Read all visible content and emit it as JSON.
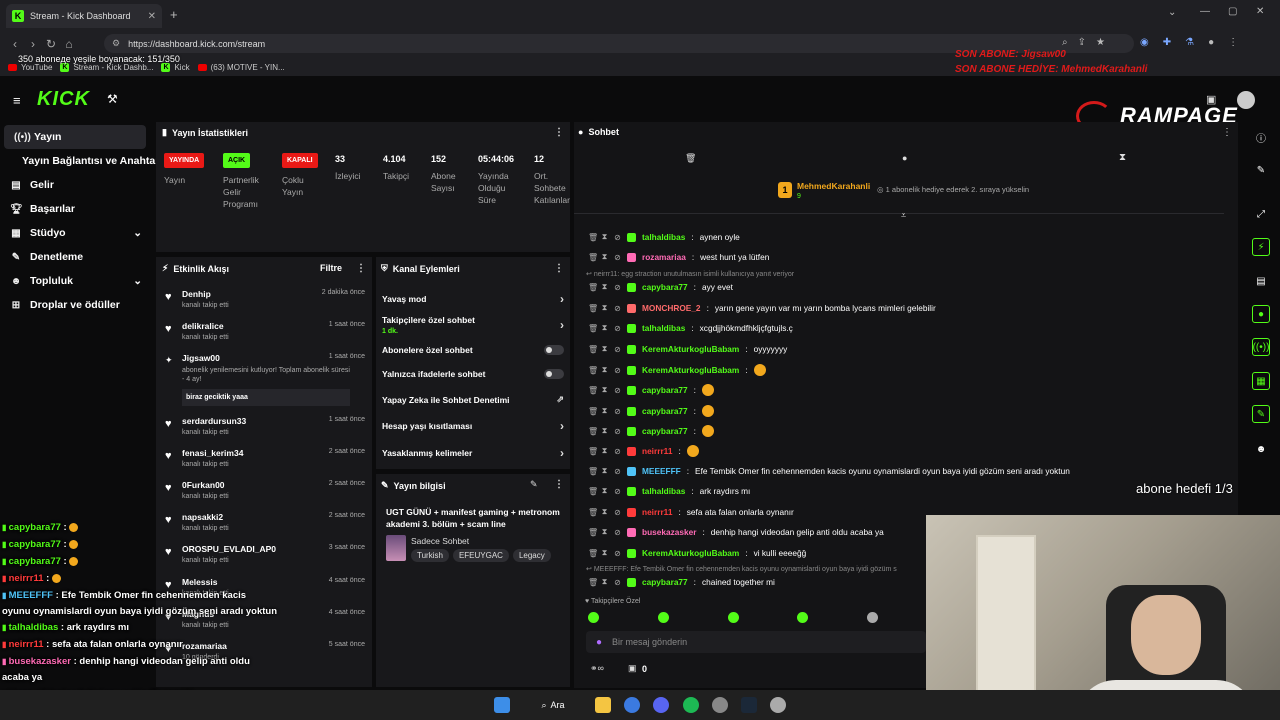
{
  "browser": {
    "tab_title": "Stream - Kick Dashboard",
    "url": "https://dashboard.kick.com/stream",
    "bookmarks": [
      "YouTube",
      "Stream - Kick Dashb...",
      "Kick",
      "(63) MOTIVE - YIN..."
    ]
  },
  "overlay": {
    "sub_goal": "350 aboneде yeşile boyanacak: 151/350",
    "last_sub": "SON ABONE: Jigsaw00",
    "last_gift": "SON ABONE HEDİYE: MehmedKarahanli",
    "brand": "RAMPAGE",
    "sub_target": "abone hedefi 1/3"
  },
  "nav": {
    "brand": "KICK",
    "items": [
      {
        "label": "Yayın",
        "icon": "broadcast-icon"
      },
      {
        "label": "Yayın Bağlantısı ve Anahtarı",
        "icon": ""
      },
      {
        "label": "Gelir",
        "icon": "wallet-icon"
      },
      {
        "label": "Başarılar",
        "icon": "trophy-icon"
      },
      {
        "label": "Stüdyo",
        "icon": "studio-icon"
      },
      {
        "label": "Denetleme",
        "icon": "wrench-icon"
      },
      {
        "label": "Topluluk",
        "icon": "people-icon"
      },
      {
        "label": "Droplar ve ödüller",
        "icon": "gift-icon"
      }
    ]
  },
  "stats": {
    "title": "Yayın İstatistikleri",
    "items": [
      {
        "badge": "YAYINDA",
        "label": "Yayın",
        "color": "#e91916"
      },
      {
        "badge": "AÇIK",
        "label": "Partnerlik Gelir Programı",
        "color": "#53fc18"
      },
      {
        "badge": "KAPALI",
        "label": "Çoklu Yayın",
        "color": "#e91916"
      },
      {
        "value": "33",
        "label": "İzleyici"
      },
      {
        "value": "4.104",
        "label": "Takipçi"
      },
      {
        "value": "152",
        "label": "Abone Sayısı"
      },
      {
        "value": "05:44:06",
        "label": "Yayında Olduğu Süre"
      },
      {
        "value": "12",
        "label": "Ort. Sohbete Katılanlar"
      }
    ]
  },
  "activity": {
    "title": "Etkinlik Akışı",
    "filter": "Filtre",
    "events": [
      {
        "name": "Denhip",
        "sub": "kanalı takip etti",
        "time": "2 dakika önce"
      },
      {
        "name": "delikralice",
        "sub": "kanalı takip etti",
        "time": "1 saat önce"
      },
      {
        "name": "Jigsaw00",
        "sub": "abonelik yenilemesini kutluyor! Toplam abonelik süresi - 4 ay!",
        "time": "1 saat önce",
        "msg": "biraz geciktik yaaa"
      },
      {
        "name": "serdardursun33",
        "sub": "kanalı takip etti",
        "time": "1 saat önce"
      },
      {
        "name": "fenasi_kerim34",
        "sub": "kanalı takip etti",
        "time": "2 saat önce"
      },
      {
        "name": "0Furkan00",
        "sub": "kanalı takip etti",
        "time": "2 saat önce"
      },
      {
        "name": "napsakki2",
        "sub": "kanalı takip etti",
        "time": "2 saat önce"
      },
      {
        "name": "OROSPU_EVLADI_AP0",
        "sub": "kanalı takip etti",
        "time": "3 saat önce"
      },
      {
        "name": "Melessis",
        "sub": "kanalı takip etti",
        "time": "4 saat önce"
      },
      {
        "name": "Magnus",
        "sub": "kanalı takip etti",
        "time": "4 saat önce"
      },
      {
        "name": "rozamariaa",
        "sub": "10 gönderdi",
        "time": "5 saat önce"
      }
    ]
  },
  "channel_actions": {
    "title": "Kanal Eylemleri",
    "items": [
      {
        "label": "Yavaş mod",
        "type": "chevron"
      },
      {
        "label": "Takipçilere özel sohbet",
        "sub": "1 dk.",
        "type": "chevron"
      },
      {
        "label": "Abonelere özel sohbet",
        "type": "toggle"
      },
      {
        "label": "Yalnızca ifadelerle sohbet",
        "type": "toggle"
      },
      {
        "label": "Yapay Zeka ile Sohbet Denetimi",
        "type": "external"
      },
      {
        "label": "Hesap yaşı kısıtlaması",
        "type": "chevron"
      },
      {
        "label": "Yasaklanmış kelimeler",
        "type": "chevron"
      }
    ]
  },
  "stream_info": {
    "title": "Yayın bilgisi",
    "stream_title": "UGT GÜNÜ + manifest gaming + metronom akademi 3. bölüm + scam line",
    "category": "Sadece Sohbet",
    "tags": [
      "Turkish",
      "EFEUYGAC",
      "Legacy"
    ]
  },
  "chat": {
    "title": "Sohbet",
    "pinned_user": "MehmedKarahanli",
    "pinned_count": "9",
    "pinned_msg": "1 abonelik hediye ederek 2. sıraya yükselin",
    "reply_note": "neirrr11: egg straction unutulmasın isimli kullanıcıya yanıt veriyor",
    "reply_note2": "MEEEFFF: Efe Tembik Omer fin cehennemden kacis oyunu oynamislardi oyun baya iyidi gözüm s",
    "messages": [
      {
        "user": "talhaldibas",
        "text": "aynen oyle",
        "color": "#53fc18"
      },
      {
        "user": "rozamariaa",
        "text": "west hunt ya lütfen",
        "color": "#ff6bb5"
      },
      {
        "user": "capybara77",
        "text": "ayy evet",
        "color": "#53fc18"
      },
      {
        "user": "MONCHROE_2",
        "text": "yarın gene yayın var mı yarın bomba lycans mimleri gelebilir",
        "color": "#ff6b6b"
      },
      {
        "user": "talhaldibas",
        "text": "xcgdjjhökmdfhkljçfgtujls.ç",
        "color": "#53fc18"
      },
      {
        "user": "KeremAkturkogluBabam",
        "text": "oyyyyyyy",
        "color": "#53fc18"
      },
      {
        "user": "KeremAkturkogluBabam",
        "text": "",
        "color": "#53fc18",
        "emote": true
      },
      {
        "user": "capybara77",
        "text": "",
        "color": "#53fc18",
        "emote": true
      },
      {
        "user": "capybara77",
        "text": "",
        "color": "#53fc18",
        "emote": true
      },
      {
        "user": "capybara77",
        "text": "",
        "color": "#53fc18",
        "emote": true
      },
      {
        "user": "neirrr11",
        "text": "",
        "color": "#ff3b3b",
        "emote": true
      },
      {
        "user": "MEEEFFF",
        "text": "Efe Tembik Omer fin cehennemden kacis oyunu oynamislardi oyun baya iyidi gözüm seni aradı yoktun",
        "color": "#4fc3f7"
      },
      {
        "user": "talhaldibas",
        "text": "ark raydırs mı",
        "color": "#53fc18"
      },
      {
        "user": "neirrr11",
        "text": "sefa ata falan onlarla oynanır",
        "color": "#ff3b3b"
      },
      {
        "user": "busekazasker",
        "text": "denhip hangi videodan gelip anti oldu acaba ya",
        "color": "#ff6bb5"
      },
      {
        "user": "KeremAkturkogluBabam",
        "text": "vi kulli eeeeğğ",
        "color": "#53fc18"
      },
      {
        "user": "capybara77",
        "text": "chained together mi",
        "color": "#53fc18"
      }
    ],
    "followers_only": "Takipçilere Özel",
    "input_placeholder": "Bir mesaj gönderin",
    "points": "0"
  },
  "overlay_chat": [
    {
      "user": "capybara77",
      "text": " : ",
      "emote": true,
      "color": "#53fc18"
    },
    {
      "user": "capybara77",
      "text": " : ",
      "emote": true,
      "color": "#53fc18"
    },
    {
      "user": "capybara77",
      "text": " : ",
      "emote": true,
      "color": "#53fc18"
    },
    {
      "user": "neirrr11",
      "text": " : ",
      "emote": true,
      "color": "#ff3b3b"
    },
    {
      "user": "MEEEFFF",
      "text": " : Efe Tembik Omer fin cehennemden kacis",
      "color": "#4fc3f7"
    },
    {
      "user": "",
      "text": "oyunu oynamislardi oyun baya iyidi gözüm seni aradı yoktun",
      "color": "#fff"
    },
    {
      "user": "talhaldibas",
      "text": " : ark raydırs mı",
      "color": "#53fc18"
    },
    {
      "user": "neirrr11",
      "text": " : sefa ata falan onlarla oynanır",
      "color": "#ff3b3b"
    },
    {
      "user": "busekazasker",
      "text": " : denhip hangi videodan gelip anti oldu",
      "color": "#ff6bb5"
    },
    {
      "user": "",
      "text": "acaba ya",
      "color": "#fff"
    },
    {
      "user": "KeremAkturkogluBabam",
      "text": " : vi kulli eeeeğğ",
      "color": "#53fc18"
    },
    {
      "user": "capybara77",
      "text": " : chained together mi",
      "color": "#53fc18"
    }
  ],
  "taskbar": {
    "search": "Ara"
  }
}
